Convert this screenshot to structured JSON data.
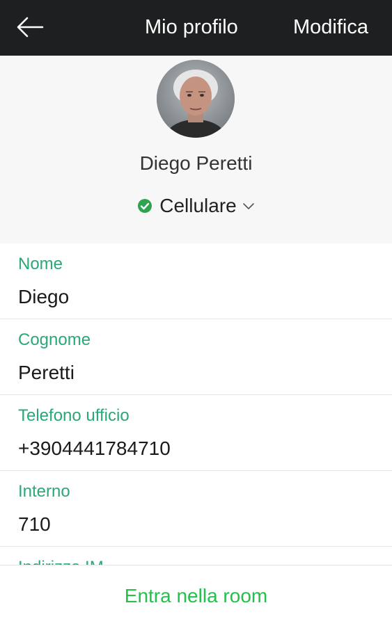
{
  "header": {
    "back_icon": "arrow-left-icon",
    "title": "Mio profilo",
    "edit_label": "Modifica"
  },
  "profile": {
    "name": "Diego Peretti",
    "status": {
      "icon": "check-circle-icon",
      "label": "Cellulare",
      "chevron_icon": "chevron-down-icon",
      "status_color": "#2ea44f"
    }
  },
  "fields": [
    {
      "label": "Nome",
      "value": "Diego"
    },
    {
      "label": "Cognome",
      "value": "Peretti"
    },
    {
      "label": "Telefono ufficio",
      "value": "+3904441784710"
    },
    {
      "label": "Interno",
      "value": "710"
    },
    {
      "label": "Indirizzo IM",
      "value": ""
    }
  ],
  "bottom": {
    "action_label": "Entra nella room"
  },
  "colors": {
    "topbar": "#1d1f21",
    "accent_label": "#2aa876",
    "action_green": "#22c24a"
  }
}
